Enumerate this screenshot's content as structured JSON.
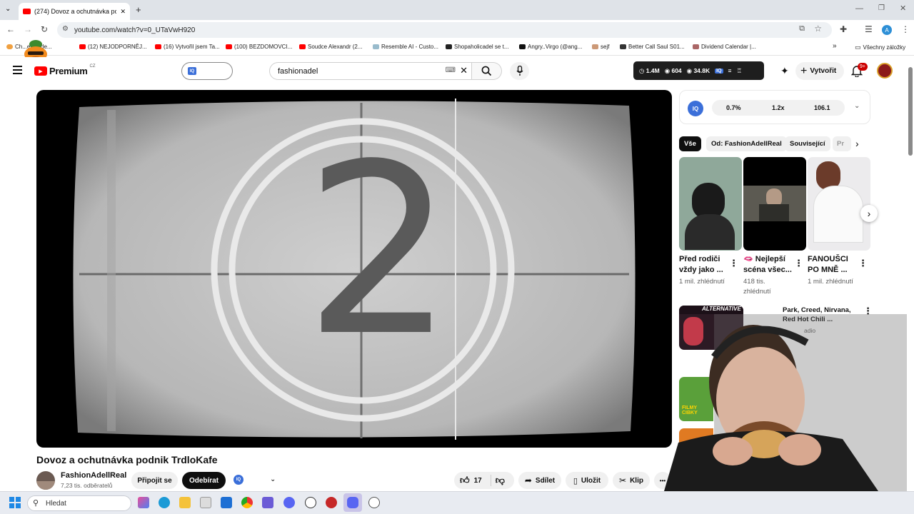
{
  "browser": {
    "tab_title": "(274) Dovoz a ochutnávka podnik",
    "tab_close": "✕",
    "new_tab": "+",
    "url": "youtube.com/watch?v=0_UTaVwH920",
    "bookmarks": [
      "Ch...eto Jide...",
      "(12) NEJODPORNĚJ...",
      "(16) Vytvořil jsem Ta...",
      "(100) BEZDOMOVCI...",
      "Soudce Alexandr (2...",
      "Resemble AI - Custo...",
      "Shopaholicadel se t...",
      "Angry..Virgo (@ang...",
      "sejf",
      "Better Call Saul S01...",
      "Dividend Calendar |..."
    ],
    "bookmarks_more": "»",
    "all_bookmarks": "Všechny záložky",
    "profile_letter": "A"
  },
  "header": {
    "logo_text": "Premium",
    "region": "CZ",
    "search_value": "fashionadel",
    "stats": {
      "views": "1.4M",
      "watch": "604",
      "subs": "34.8K"
    },
    "create_label": "Vytvořit",
    "notif_badge": "9+"
  },
  "video": {
    "countdown_digit": "2",
    "title": "Dovoz a ochutnávka podnik TrdloKafe",
    "channel": "FashionAdellReal",
    "subscribers": "7,23 tis. odběratelů",
    "join_label": "Připojit se",
    "subscribe_label": "Odebírat",
    "likes": "17",
    "share_label": "Sdílet",
    "save_label": "Uložit",
    "clip_label": "Klip",
    "more": "•••"
  },
  "sidebar": {
    "iq_values": [
      "0.7%",
      "1.2x",
      "106.1"
    ],
    "chips": [
      "Vše",
      "Od: FashionAdellReal",
      "Související",
      "Pr"
    ],
    "shorts": [
      {
        "title": "Před rodiči vždy jako ...",
        "meta": "1 mil. zhlédnutí"
      },
      {
        "title": "🫦 Nejlepší scéna všec...",
        "meta": "418 tis. zhlédnutí"
      },
      {
        "title": "FANOUŠCI PO MNĚ ...",
        "meta": "1 mil. zhlédnutí"
      }
    ],
    "mix_title": "Park, Creed, Nirvana, Red Hot Chili ...",
    "mix_meta": "adio",
    "mix_thumb_text": "ALTERNATIVE",
    "next_thumb_text": "FILMY CIBKY"
  },
  "taskbar": {
    "search_placeholder": "Hledat"
  },
  "colors": {
    "youtube_red": "#ff0000",
    "dark_button": "#0f0f0f",
    "iq_blue": "#3b6fd9"
  }
}
